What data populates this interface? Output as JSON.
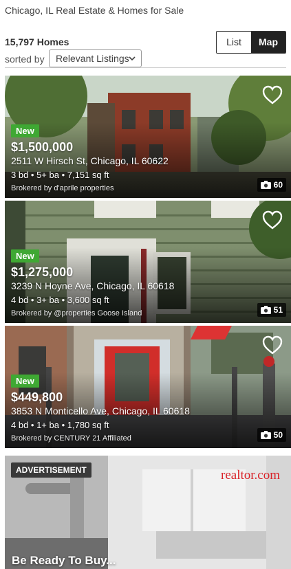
{
  "header": {
    "title": "Chicago, IL Real Estate & Homes for Sale",
    "count": "15,797 Homes",
    "sorted_by_label": "sorted by",
    "sort_value": "Relevant Listings",
    "view_toggle": {
      "list_label": "List",
      "map_label": "Map",
      "active": "Map"
    }
  },
  "listings": [
    {
      "badge": "New",
      "price": "$1,500,000",
      "address": "2511 W Hirsch St, Chicago, IL 60622",
      "specs": "3 bd • 5+ ba • 7,151 sq ft",
      "broker": "Brokered by d'aprile properties",
      "photo_count": "60"
    },
    {
      "badge": "New",
      "price": "$1,275,000",
      "address": "3239 N Hoyne Ave, Chicago, IL 60618",
      "specs": "4 bd • 3+ ba • 3,600 sq ft",
      "broker": "Brokered by @properties Goose Island",
      "photo_count": "51"
    },
    {
      "badge": "New",
      "price": "$449,800",
      "address": "3853 N Monticello Ave, Chicago, IL 60618",
      "specs": "4 bd • 1+ ba • 1,780 sq ft",
      "broker": "Brokered by CENTURY 21 Affiliated",
      "photo_count": "50"
    }
  ],
  "ad": {
    "label": "ADVERTISEMENT",
    "brand": "realtor.com",
    "headline": "Be Ready To Buy..."
  },
  "colors": {
    "new_badge": "#3fa833",
    "brand_red": "#d92228",
    "toggle_active": "#222222"
  }
}
